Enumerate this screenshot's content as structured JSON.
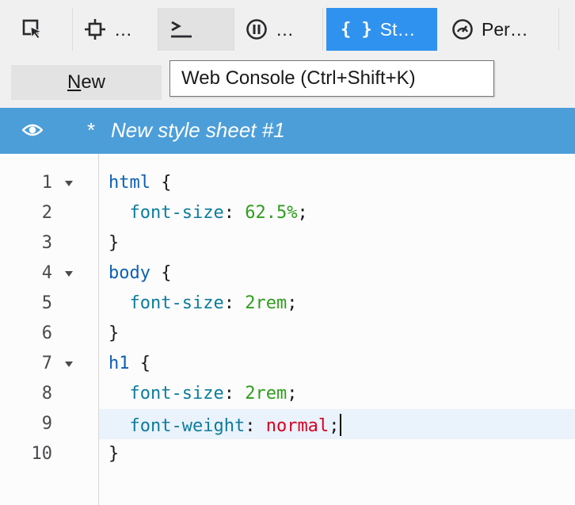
{
  "toolbar": {
    "tabs": [
      {
        "id": "picker",
        "label": "",
        "icon": "element-picker-icon"
      },
      {
        "id": "inspector",
        "label": "…",
        "icon": "inspector-icon"
      },
      {
        "id": "console",
        "label": "",
        "icon": "console-icon"
      },
      {
        "id": "debugger",
        "label": "…",
        "icon": "debugger-icon"
      },
      {
        "id": "style-editor",
        "label": "St…",
        "icon": "style-editor-icon",
        "selected": true
      },
      {
        "id": "performance",
        "label": "Per…",
        "icon": "performance-icon"
      }
    ]
  },
  "subbar": {
    "new_label": "New",
    "new_accesskey": "N",
    "new_rest": "ew"
  },
  "tooltip": {
    "text": "Web Console (Ctrl+Shift+K)"
  },
  "stylesheet": {
    "modified_marker": "*",
    "name": "New style sheet #1"
  },
  "editor": {
    "lines": [
      {
        "n": "1",
        "fold": true
      },
      {
        "n": "2",
        "fold": false
      },
      {
        "n": "3",
        "fold": false
      },
      {
        "n": "4",
        "fold": true
      },
      {
        "n": "5",
        "fold": false
      },
      {
        "n": "6",
        "fold": false
      },
      {
        "n": "7",
        "fold": true
      },
      {
        "n": "8",
        "fold": false
      },
      {
        "n": "9",
        "fold": false,
        "active": true
      },
      {
        "n": "10",
        "fold": false
      }
    ],
    "code": {
      "l1_selector": "html",
      "l1_brace": " {",
      "l2_prop": "font-size",
      "l2_colon": ": ",
      "l2_value": "62.5%",
      "l2_semi": ";",
      "l3": "}",
      "l4_selector": "body",
      "l4_brace": " {",
      "l5_prop": "font-size",
      "l5_colon": ": ",
      "l5_value": "2rem",
      "l5_semi": ";",
      "l6": "}",
      "l7_selector": "h1",
      "l7_brace": " {",
      "l8_prop": "font-size",
      "l8_colon": ": ",
      "l8_value": "2rem",
      "l8_semi": ";",
      "l9_prop": "font-weight",
      "l9_colon": ": ",
      "l9_value": "normal",
      "l9_semi": ";",
      "l10": "}"
    }
  },
  "colors": {
    "accent": "#3092ef",
    "sheet_row": "#4c9ed9",
    "selector": "#0c61b5",
    "property": "#0c7d9c",
    "value": "#2f9e1e",
    "keyword": "#d70022"
  }
}
